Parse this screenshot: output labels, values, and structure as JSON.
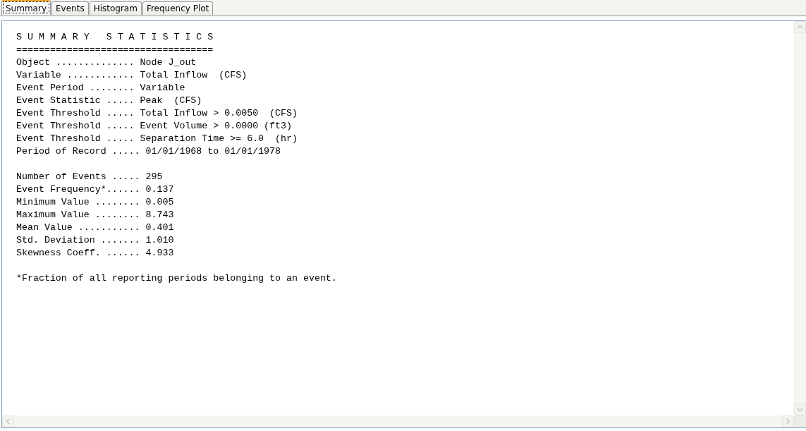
{
  "tabs": [
    {
      "label": "Summary",
      "selected": true
    },
    {
      "label": "Events",
      "selected": false
    },
    {
      "label": "Histogram",
      "selected": false
    },
    {
      "label": "Frequency Plot",
      "selected": false
    }
  ],
  "report": {
    "sections": [
      [
        "S U M M A R Y   S T A T I S T I C S",
        "===================================",
        "Object .............. Node J_out",
        "Variable ............ Total Inflow  (CFS)",
        "Event Period ........ Variable",
        "Event Statistic ..... Peak  (CFS)",
        "Event Threshold ..... Total Inflow > 0.0050  (CFS)",
        "Event Threshold ..... Event Volume > 0.0000 (ft3)",
        "Event Threshold ..... Separation Time >= 6.0  (hr)",
        "Period of Record ..... 01/01/1968 to 01/01/1978"
      ],
      [
        "Number of Events ..... 295",
        "Event Frequency*...... 0.137",
        "Minimum Value ........ 0.005",
        "Maximum Value ........ 8.743",
        "Mean Value ........... 0.401",
        "Std. Deviation ....... 1.010",
        "Skewness Coeff. ...... 4.933"
      ],
      [
        "*Fraction of all reporting periods belonging to an event."
      ]
    ]
  }
}
